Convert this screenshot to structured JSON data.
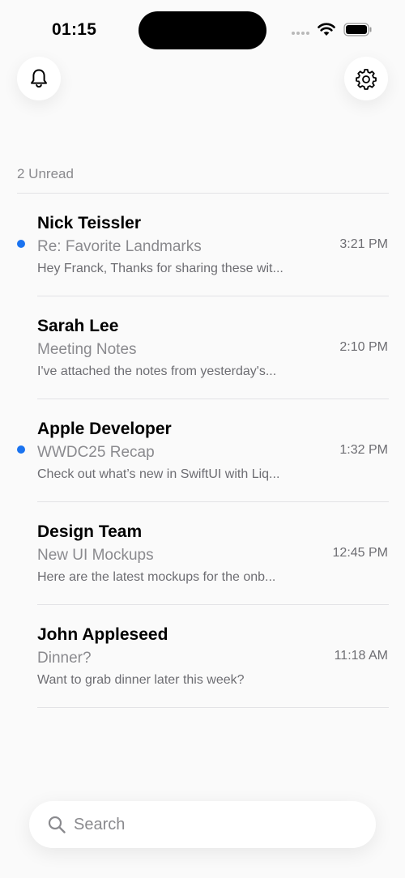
{
  "status_bar": {
    "time": "01:15"
  },
  "toolbar": {
    "bell_icon": "bell-icon",
    "settings_icon": "gear-icon"
  },
  "list": {
    "header": "2 Unread",
    "items": [
      {
        "sender": "Nick Teissler",
        "subject": "Re: Favorite Landmarks",
        "preview": "Hey Franck, Thanks for sharing these wit...",
        "time": "3:21 PM",
        "unread": true
      },
      {
        "sender": "Sarah Lee",
        "subject": "Meeting Notes",
        "preview": "I've attached the notes from yesterday's...",
        "time": "2:10 PM",
        "unread": false
      },
      {
        "sender": "Apple Developer",
        "subject": "WWDC25 Recap",
        "preview": "Check out what’s new in SwiftUI with Liq...",
        "time": "1:32 PM",
        "unread": true
      },
      {
        "sender": "Design Team",
        "subject": "New UI Mockups",
        "preview": "Here are the latest mockups for the onb...",
        "time": "12:45 PM",
        "unread": false
      },
      {
        "sender": "John Appleseed",
        "subject": "Dinner?",
        "preview": "Want to grab dinner later this week?",
        "time": "11:18 AM",
        "unread": false
      }
    ]
  },
  "search": {
    "placeholder": "Search",
    "value": ""
  },
  "colors": {
    "accent": "#1a73f0",
    "secondary_text": "#8a8a8e",
    "background": "#fafafa"
  }
}
